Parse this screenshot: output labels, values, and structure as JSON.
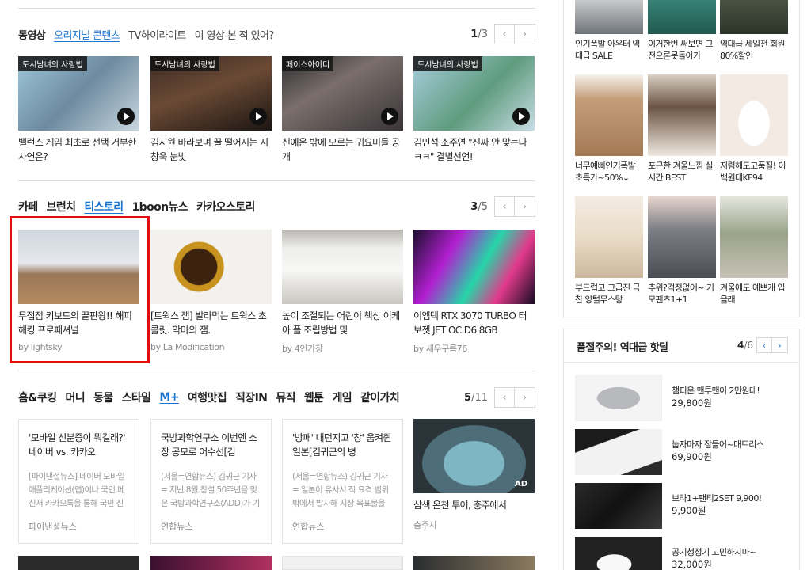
{
  "video": {
    "tabs": [
      "동영상",
      "오리지널 콘텐츠",
      "TV하이라이트",
      "이 영상 본 적 있어?"
    ],
    "page_current": "1",
    "page_total": "/3",
    "cards": [
      {
        "badge": "도시남녀의 사랑법",
        "title": "밸런스 게임 최초로 선택 거부한 사연은?"
      },
      {
        "badge": "도시남녀의 사랑법",
        "title": "김지원 바라보며 꿀 떨어지는 지창욱 눈빛"
      },
      {
        "badge": "페이스아이디",
        "title": "신예은 밖에 모르는 귀요미들 공개"
      },
      {
        "badge": "도시남녀의 사랑법",
        "title": "김민석·소주연 \"진짜 안 맞는다ㅋㅋ\" 결별선언!"
      }
    ]
  },
  "cafe": {
    "tabs": [
      "카페",
      "브런치",
      "티스토리",
      "1boon뉴스",
      "카카오스토리"
    ],
    "page_current": "3",
    "page_total": "/5",
    "cards": [
      {
        "title": "무접점 키보드의 끝판왕!! 해피해킹 프로페셔널",
        "by": "by lightsky"
      },
      {
        "title": "[트윅스 잼] 발라먹는 트윅스 초콜릿. 악마의 잼.",
        "by": "by La Modification"
      },
      {
        "title": "높이 조절되는 어린이 책상 이케아 폴 조립방법 및",
        "by": "by 4인가장"
      },
      {
        "title": "이엠텍 RTX 3070 TURBO 터보젯 JET OC D6 8GB",
        "by": "by 새우구름76"
      }
    ]
  },
  "home": {
    "tabs": [
      "홈&쿠킹",
      "머니",
      "동물",
      "스타일",
      "M+",
      "여행맛집",
      "직장IN",
      "뮤직",
      "웹툰",
      "게임",
      "같이가치"
    ],
    "page_current": "5",
    "page_total": "/11",
    "news": [
      {
        "title": "'모바일 신분증이 뭐길래?' 네이버 vs. 카카오",
        "desc": "[파이낸셜뉴스] 네이버 모바일 애플리케이션(앱)이나 국민 메신저 카카오톡을 통해 국민 신",
        "source": "파이낸셜뉴스"
      },
      {
        "title": "국방과학연구소 이번엔 소장 공모로 어수선[김",
        "desc": "(서울=연합뉴스) 김귀근 기자 = 지난 8월 창설 50주년을 맞은 국방과학연구소(ADD)가 기",
        "source": "연합뉴스"
      },
      {
        "title": "'방패' 내던지고 '창' 움켜쥔 일본[김귀근의 병",
        "desc": "(서울=연합뉴스) 김귀근 기자 = 일본이 유사시 적 요격 범위 밖에서 발사해 지상 목표물을",
        "source": "연합뉴스"
      }
    ],
    "ad": {
      "title": "삼색 온천 투어, 충주에서",
      "source": "충주시",
      "badge": "AD"
    }
  },
  "shopping": {
    "products": [
      {
        "title": "인기폭발 아우터 역대급 SALE"
      },
      {
        "title": "이거한번 써보면 그전으론못돌아가"
      },
      {
        "title": "역대급 세일전 회원 80%할인"
      },
      {
        "title": "너무예뻐인기폭발 초특가~50%↓"
      },
      {
        "title": "포근한 겨울느낌 실시간 BEST"
      },
      {
        "title": "저렴해도고품질! 이백원대KF94"
      },
      {
        "title": "부드럽고 고급진 극찬 양털무스탕"
      },
      {
        "title": "추위?걱정없어~ 기모팬츠1+1"
      },
      {
        "title": "겨울에도 예쁘게 입을래"
      }
    ]
  },
  "hotdeal": {
    "title": "품절주의! 역대급 핫딜",
    "page_current": "4",
    "page_total": "/6",
    "items": [
      {
        "title": "챔피온 맨투맨이 2만원대!",
        "price": "29,800원"
      },
      {
        "title": "눕자마자 잠들어~매트리스",
        "price": "69,900원"
      },
      {
        "title": "브라1+팬티2SET 9,900!",
        "price": "9,900원"
      },
      {
        "title": "공기청정기 고민하지마~",
        "price": "32,000원"
      }
    ]
  },
  "icons": {
    "prev": "‹",
    "next": "›"
  }
}
